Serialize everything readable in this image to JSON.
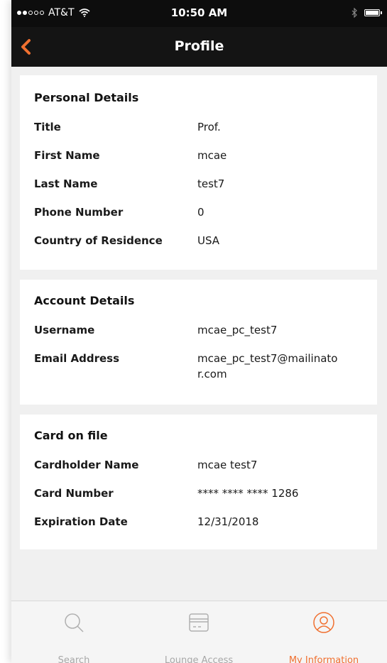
{
  "status_bar": {
    "carrier": "AT&T",
    "time": "10:50 AM"
  },
  "nav": {
    "title": "Profile",
    "accent_color": "#f07030"
  },
  "personal_details": {
    "heading": "Personal Details",
    "rows": [
      {
        "label": "Title",
        "value": "Prof."
      },
      {
        "label": "First Name",
        "value": "mcae"
      },
      {
        "label": "Last Name",
        "value": "test7"
      },
      {
        "label": "Phone Number",
        "value": "0"
      },
      {
        "label": "Country of Residence",
        "value": "USA"
      }
    ]
  },
  "account_details": {
    "heading": "Account Details",
    "rows": [
      {
        "label": "Username",
        "value": "mcae_pc_test7"
      },
      {
        "label": "Email Address",
        "value": "mcae_pc_test7@mailinator.com"
      }
    ]
  },
  "card_on_file": {
    "heading": "Card on file",
    "rows": [
      {
        "label": "Cardholder Name",
        "value": "mcae test7"
      },
      {
        "label": "Card Number",
        "value": "**** **** **** 1286"
      },
      {
        "label": "Expiration Date",
        "value": "12/31/2018"
      }
    ]
  },
  "tab_bar": {
    "tabs": [
      {
        "label": "Search",
        "icon": "search-icon",
        "active": false
      },
      {
        "label": "Lounge Access",
        "icon": "card-icon",
        "active": false
      },
      {
        "label": "My Information",
        "icon": "user-icon",
        "active": true
      }
    ],
    "active_color": "#f07030",
    "inactive_color": "#a8a8a8"
  }
}
